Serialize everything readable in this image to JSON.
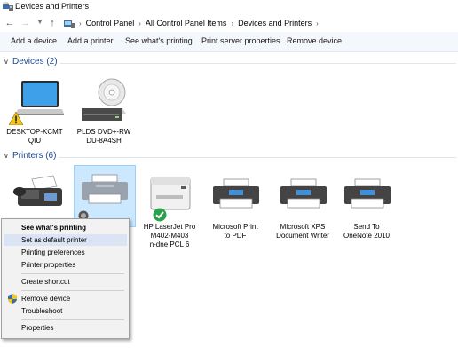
{
  "window": {
    "title": "Devices and Printers"
  },
  "address": {
    "crumbs": [
      "Control Panel",
      "All Control Panel Items",
      "Devices and Printers"
    ]
  },
  "toolbar": {
    "add_device": "Add a device",
    "add_printer": "Add a printer",
    "whats_printing": "See what's printing",
    "print_server": "Print server properties",
    "remove_device": "Remove device"
  },
  "sections": {
    "devices": "Devices (2)",
    "printers": "Printers (6)"
  },
  "devices": [
    {
      "name_line1": "DESKTOP-KCMT",
      "name_line2": "QIU",
      "status": "warning"
    },
    {
      "name_line1": "PLDS DVD+-RW",
      "name_line2": "DU-8A4SH"
    }
  ],
  "printers": [
    {
      "name_lines": [
        "HP LaserJet Pro",
        "M402-M403",
        "n-dne PCL 6"
      ],
      "status": "default"
    },
    {
      "name_lines": [
        "Microsoft Print",
        "to PDF"
      ]
    },
    {
      "name_lines": [
        "Microsoft XPS",
        "Document Writer"
      ]
    },
    {
      "name_lines": [
        "Send To",
        "OneNote 2010"
      ]
    }
  ],
  "context_menu": {
    "items": [
      {
        "label": "See what's printing",
        "bold": true
      },
      {
        "label": "Set as default printer",
        "highlighted": true
      },
      {
        "label": "Printing preferences"
      },
      {
        "label": "Printer properties"
      },
      {
        "label": "Create shortcut"
      },
      {
        "label": "Remove device",
        "icon": "shield-icon"
      },
      {
        "label": "Troubleshoot"
      },
      {
        "label": "Properties"
      }
    ]
  },
  "colors": {
    "section_header": "#1e4a92",
    "selection_bg": "#cce8ff",
    "menu_highlight": "#dbe4f4",
    "check_green": "#2aa24b",
    "warning_yellow": "#f5c518"
  }
}
